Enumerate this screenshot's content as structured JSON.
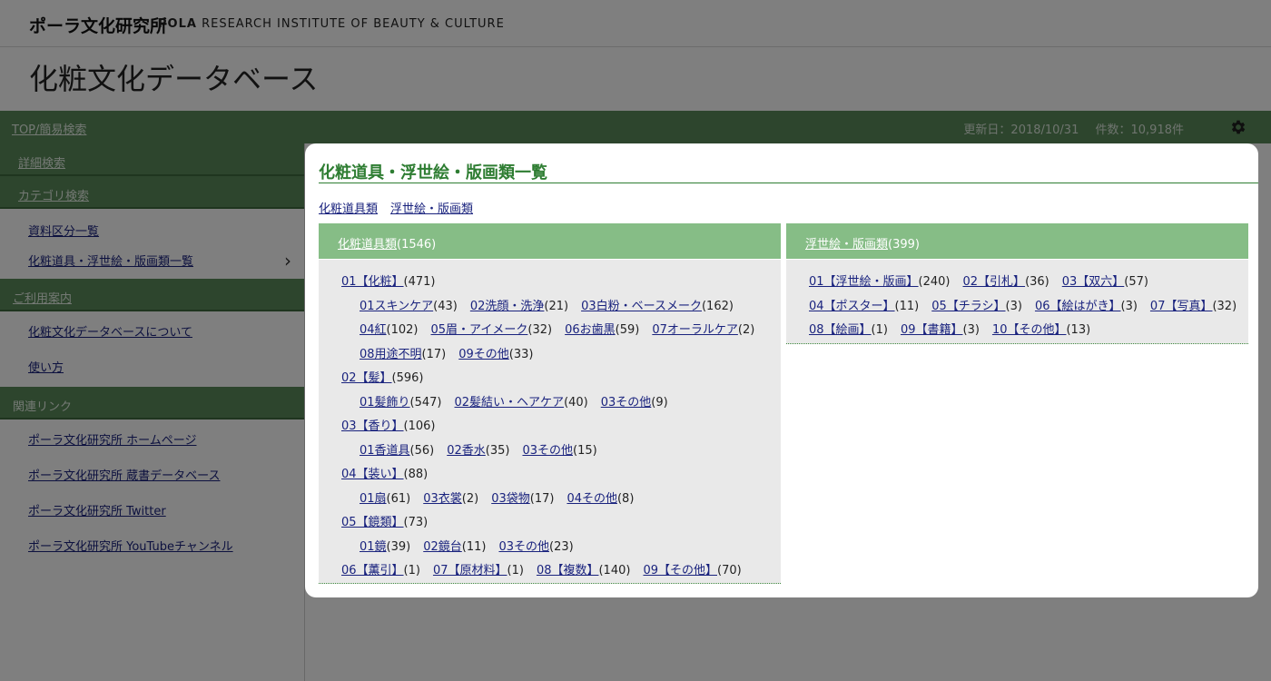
{
  "header": {
    "logo_jp": "ポーラ文化研究所",
    "logo_en_bold": "POLA",
    "logo_en_rest": " RESEARCH INSTITUTE OF BEAUTY & CULTURE",
    "site_title": "化粧文化データベース"
  },
  "greenbar": {
    "top_link": "TOP/簡易検索",
    "updated": "更新日：2018/10/31",
    "count": "件数：10,918件"
  },
  "sidebar": {
    "detail_search": "詳細検索",
    "category_search": "カテゴリ検索",
    "category_items": [
      "資料区分一覧",
      "化粧道具・浮世絵・版画類一覧"
    ],
    "guide_head": "ご利用案内",
    "guide_items": [
      "化粧文化データベースについて",
      "使い方"
    ],
    "links_head": "関連リンク",
    "link_items": [
      "ポーラ文化研究所 ホームページ",
      "ポーラ文化研究所 蔵書データベース",
      "ポーラ文化研究所 Twitter",
      "ポーラ文化研究所 YouTubeチャンネル"
    ]
  },
  "modal": {
    "title": "化粧道具・浮世絵・版画類一覧",
    "tabs": [
      "化粧道具類",
      "浮世絵・版画類"
    ],
    "left": {
      "head_label": "化粧道具類",
      "head_count": "(1546)",
      "rows": [
        [
          [
            "01【化粧】",
            "(471)"
          ]
        ],
        [
          [
            "01スキンケア",
            "(43)"
          ],
          [
            "02洗顔・洗浄",
            "(21)"
          ],
          [
            "03白粉・ベースメーク",
            "(162)"
          ]
        ],
        [
          [
            "04紅",
            "(102)"
          ],
          [
            "05眉・アイメーク",
            "(32)"
          ],
          [
            "06お歯黒",
            "(59)"
          ],
          [
            "07オーラルケア",
            "(2)"
          ]
        ],
        [
          [
            "08用途不明",
            "(17)"
          ],
          [
            "09その他",
            "(33)"
          ]
        ],
        [
          [
            "02【髪】",
            "(596)"
          ]
        ],
        [
          [
            "01髪飾り",
            "(547)"
          ],
          [
            "02髪結い・ヘアケア",
            "(40)"
          ],
          [
            "03その他",
            "(9)"
          ]
        ],
        [
          [
            "03【香り】",
            "(106)"
          ]
        ],
        [
          [
            "01香道具",
            "(56)"
          ],
          [
            "02香水",
            "(35)"
          ],
          [
            "03その他",
            "(15)"
          ]
        ],
        [
          [
            "04【装い】",
            "(88)"
          ]
        ],
        [
          [
            "01扇",
            "(61)"
          ],
          [
            "03衣裳",
            "(2)"
          ],
          [
            "03袋物",
            "(17)"
          ],
          [
            "04その他",
            "(8)"
          ]
        ],
        [
          [
            "05【鏡類】",
            "(73)"
          ]
        ],
        [
          [
            "01鏡",
            "(39)"
          ],
          [
            "02鏡台",
            "(11)"
          ],
          [
            "03その他",
            "(23)"
          ]
        ],
        [
          [
            "06【薫引】",
            "(1)"
          ],
          [
            "07【原材料】",
            "(1)"
          ],
          [
            "08【複数】",
            "(140)"
          ],
          [
            "09【その他】",
            "(70)"
          ]
        ]
      ]
    },
    "right": {
      "head_label": "浮世絵・版画類",
      "head_count": "(399)",
      "rows": [
        [
          [
            "01【浮世絵・版画】",
            "(240)"
          ],
          [
            "02【引札】",
            "(36)"
          ],
          [
            "03【双六】",
            "(57)"
          ]
        ],
        [
          [
            "04【ポスター】",
            "(11)"
          ],
          [
            "05【チラシ】",
            "(3)"
          ],
          [
            "06【絵はがき】",
            "(3)"
          ],
          [
            "07【写真】",
            "(32)"
          ]
        ],
        [
          [
            "08【絵画】",
            "(1)"
          ],
          [
            "09【書籍】",
            "(3)"
          ],
          [
            "10【その他】",
            "(13)"
          ]
        ]
      ]
    }
  }
}
